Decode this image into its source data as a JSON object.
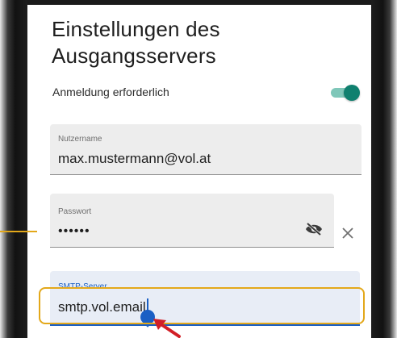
{
  "screen": {
    "title_line1": "Einstellungen des",
    "title_line2": "Ausgangsservers"
  },
  "auth_toggle": {
    "label": "Anmeldung erforderlich",
    "enabled": true
  },
  "username_field": {
    "label": "Nutzername",
    "value": "max.mustermann@vol.at"
  },
  "password_field": {
    "label": "Passwort",
    "value": "••••••",
    "visibility_icon": "eye-off-icon",
    "clear_icon": "close-icon"
  },
  "smtp_field": {
    "label": "SMTP-Server",
    "value": "smtp.vol.email",
    "focused": true
  },
  "colors": {
    "accent_teal": "#10806f",
    "focus_blue": "#1a5fc4",
    "highlight_orange": "#e3a81a",
    "arrow_red": "#d21f26"
  }
}
